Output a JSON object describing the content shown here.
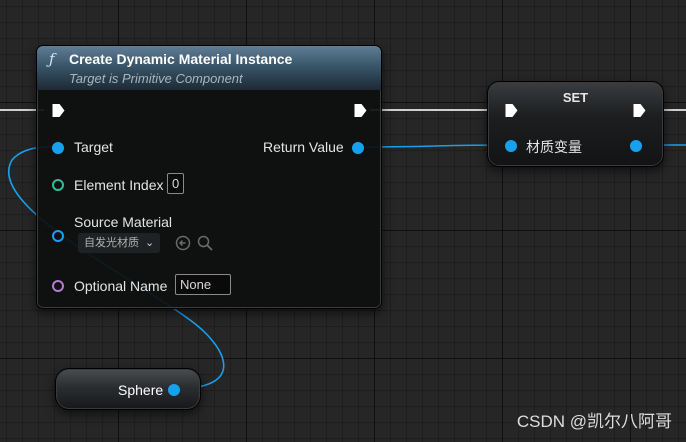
{
  "colors": {
    "background": "#262626",
    "object_pin": "#17a0ee",
    "int_pin": "#2fbe98",
    "name_pin": "#b57bd4",
    "exec_wire": "#d9d9d9"
  },
  "create_node": {
    "icon": "function-icon",
    "title": "Create Dynamic Material Instance",
    "subtitle": "Target is Primitive Component",
    "pins": {
      "target": "Target",
      "element_index": "Element Index",
      "element_index_value": "0",
      "source_material": "Source Material",
      "source_material_value": "自发光材质",
      "optional_name": "Optional Name",
      "optional_name_value": "None",
      "return_value": "Return Value"
    }
  },
  "set_node": {
    "title": "SET",
    "variable": "材质变量"
  },
  "sphere_node": {
    "label": "Sphere"
  },
  "watermark": "CSDN @凯尔八阿哥"
}
